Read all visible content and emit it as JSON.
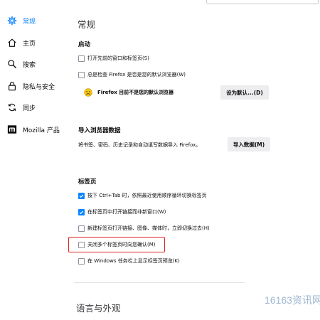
{
  "sidebar": {
    "items": [
      {
        "label": "常规",
        "icon": "gear-icon",
        "active": true
      },
      {
        "label": "主页",
        "icon": "home-icon",
        "active": false
      },
      {
        "label": "搜索",
        "icon": "search-icon",
        "active": false
      },
      {
        "label": "隐私与安全",
        "icon": "lock-icon",
        "active": false
      },
      {
        "label": "同步",
        "icon": "sync-icon",
        "active": false
      },
      {
        "label": "Mozilla 产品",
        "icon": "mozilla-logo-icon",
        "active": false
      }
    ]
  },
  "main": {
    "page_title": "常规",
    "startup": {
      "title": "启动",
      "restore_session": "打开先前的窗口和标签页(S)",
      "check_default": "总是检查 Firefox 是否是您的默认浏览器(W)",
      "not_default_text": "Firefox 目前不是您的默认浏览器",
      "set_default_button": "设为默认...(D)"
    },
    "import": {
      "title": "导入浏览器数据",
      "description": "将书签、密码、历史记录和自动填写数据导入 Firefox。",
      "button": "导入数据(M)"
    },
    "tabs": {
      "title": "标签页",
      "options": [
        {
          "label": "按下 Ctrl+Tab 时，依照最近使用顺序循环切换标签页",
          "checked": true
        },
        {
          "label": "在标签页中打开链接而非新窗口(W)",
          "checked": true
        },
        {
          "label": "新建标签页打开链接、图像、媒体时，立即切换过去(H)",
          "checked": false
        },
        {
          "label": "关闭多个标签页时向您确认(M)",
          "checked": false
        },
        {
          "label": "在 Windows 任务栏上显示标签页预览(K)",
          "checked": false
        }
      ]
    },
    "language_title": "语言与外观"
  },
  "watermark": "16163资讯网",
  "colors": {
    "accent": "#0a84ff",
    "highlight": "#e02424",
    "button_bg": "#ededf0",
    "emoji": "#f5c518"
  }
}
